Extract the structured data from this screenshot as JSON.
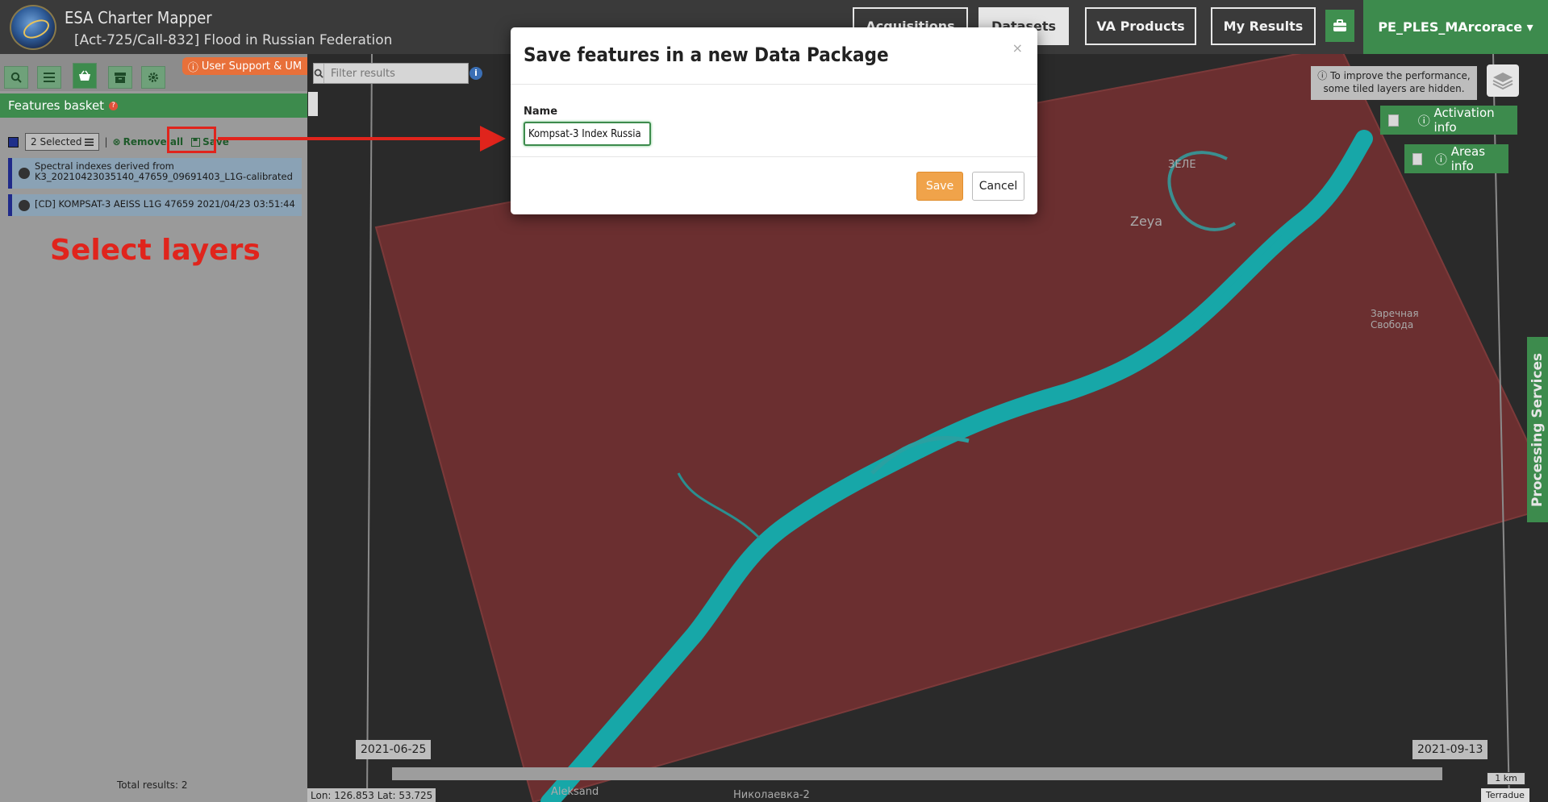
{
  "header": {
    "app_title": "ESA Charter Mapper",
    "subtitle": "[Act-725/Call-832] Flood in Russian Federation",
    "nav": [
      {
        "label": "Acquisitions"
      },
      {
        "label": "Datasets"
      },
      {
        "label": "VA Products"
      },
      {
        "label": "My Results"
      }
    ],
    "user": "PE_PLES_MArcorace ▾"
  },
  "left_panel": {
    "support_label": "User Support & UM",
    "basket_title": "Features basket",
    "selected_label": "2 Selected",
    "remove_all_label": "Remove all",
    "save_label": "Save",
    "items": [
      {
        "text": "Spectral indexes derived from K3_20210423035140_47659_09691403_L1G-calibrated"
      },
      {
        "text": "[CD] KOMPSAT-3 AEISS L1G 47659 2021/04/23 03:51:44"
      }
    ],
    "annotation": "Select layers",
    "total_results": "Total results: 2"
  },
  "map": {
    "filter_placeholder": "Filter results",
    "perf_note": "To improve the performance, some tiled layers are hidden.",
    "activation_info": "Activation info",
    "areas_info": "Areas info",
    "processing_services": "Processing Services",
    "date_start": "2021-06-25",
    "date_end": "2021-09-13",
    "coords": "Lon: 126.853 Lat: 53.725",
    "scale": "1 km",
    "attribution": "Terradue",
    "places": [
      "Zeya",
      "Aleksand",
      "Николаевка-2",
      "Заречная Свобода",
      "ЗЕЛЕ"
    ]
  },
  "modal": {
    "title": "Save features in a new Data Package",
    "close": "×",
    "name_label": "Name",
    "name_value": "Kompsat-3 Index Russia",
    "save_button": "Save",
    "cancel_button": "Cancel"
  },
  "colors": {
    "brand_green": "#3d8b4d",
    "accent_orange": "#f0a34a",
    "annotation_red": "#e0241c",
    "water_cyan": "#17a7a8",
    "scene_red": "#6a2e2e"
  }
}
